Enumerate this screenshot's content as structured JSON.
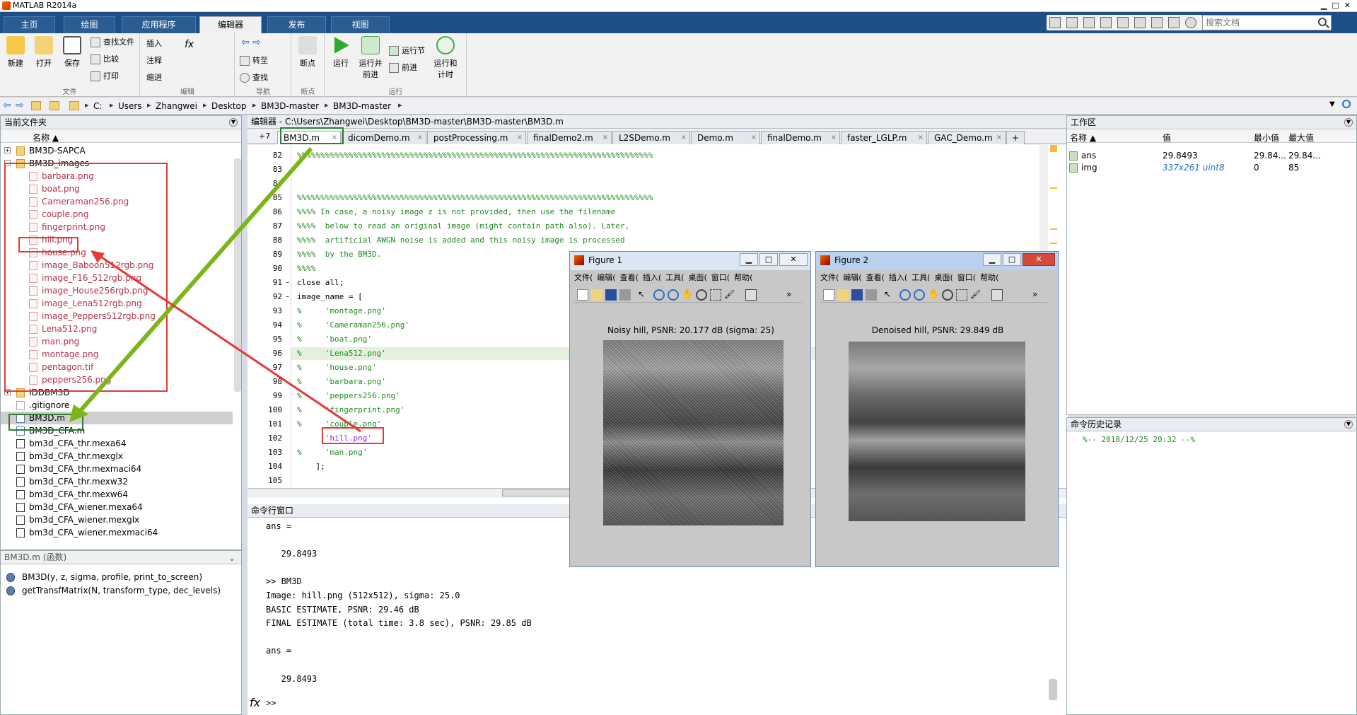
{
  "window": {
    "title": "MATLAB R2014a"
  },
  "ribbon_tabs": [
    "主页",
    "绘图",
    "应用程序",
    "编辑器",
    "发布",
    "视图"
  ],
  "search": {
    "placeholder": "搜索文档"
  },
  "toolstrip": {
    "file": {
      "label": "文件",
      "new": "新建",
      "open": "打开",
      "save": "保存",
      "find_files": "查找文件",
      "compare": "比较",
      "print": "打印"
    },
    "edit": {
      "label": "编辑",
      "insert": "插入",
      "comment": "注释",
      "indent": "缩进"
    },
    "navigate": {
      "label": "导航",
      "goto": "转至",
      "find": "查找"
    },
    "breakpoints": {
      "label": "断点",
      "breakpoints": "断点"
    },
    "run": {
      "label": "运行",
      "run": "运行",
      "run_advance_1": "运行并",
      "run_advance_2": "前进",
      "run_section": "运行节",
      "advance": "前进",
      "run_time_1": "运行和",
      "run_time_2": "计时"
    }
  },
  "breadcrumb": [
    "C:",
    "Users",
    "Zhangwei",
    "Desktop",
    "BM3D-master",
    "BM3D-master"
  ],
  "current_folder": {
    "title": "当前文件夹",
    "name_col": "名称 ▲",
    "items": [
      {
        "name": "BM3D-SAPCA",
        "type": "folder"
      },
      {
        "name": "BM3D_images",
        "type": "folder"
      },
      {
        "name": "barbara.png",
        "type": "png"
      },
      {
        "name": "boat.png",
        "type": "png"
      },
      {
        "name": "Cameraman256.png",
        "type": "png"
      },
      {
        "name": "couple.png",
        "type": "png"
      },
      {
        "name": "fingerprint.png",
        "type": "png"
      },
      {
        "name": "hill.png",
        "type": "png"
      },
      {
        "name": "house.png",
        "type": "png"
      },
      {
        "name": "image_Baboon512rgb.png",
        "type": "png"
      },
      {
        "name": "image_F16_512rgb.png",
        "type": "png"
      },
      {
        "name": "image_House256rgb.png",
        "type": "png"
      },
      {
        "name": "image_Lena512rgb.png",
        "type": "png"
      },
      {
        "name": "image_Peppers512rgb.png",
        "type": "png"
      },
      {
        "name": "Lena512.png",
        "type": "png"
      },
      {
        "name": "man.png",
        "type": "png"
      },
      {
        "name": "montage.png",
        "type": "png"
      },
      {
        "name": "pentagon.tif",
        "type": "tif"
      },
      {
        "name": "peppers256.png",
        "type": "png"
      },
      {
        "name": "IDDBM3D",
        "type": "folder"
      },
      {
        "name": ".gitignore",
        "type": "file"
      },
      {
        "name": "BM3D.m",
        "type": "m"
      },
      {
        "name": "BM3D_CFA.m",
        "type": "m"
      },
      {
        "name": "bm3d_CFA_thr.mexa64",
        "type": "mex"
      },
      {
        "name": "bm3d_CFA_thr.mexglx",
        "type": "mex"
      },
      {
        "name": "bm3d_CFA_thr.mexmaci64",
        "type": "mex"
      },
      {
        "name": "bm3d_CFA_thr.mexw32",
        "type": "mex"
      },
      {
        "name": "bm3d_CFA_thr.mexw64",
        "type": "mex"
      },
      {
        "name": "bm3d_CFA_wiener.mexa64",
        "type": "mex"
      },
      {
        "name": "bm3d_CFA_wiener.mexglx",
        "type": "mex"
      },
      {
        "name": "bm3d_CFA_wiener.mexmaci64",
        "type": "mex"
      }
    ]
  },
  "details": {
    "title": "BM3D.m (函数)",
    "functions": [
      "BM3D(y, z, sigma, profile, print_to_screen)",
      "getTransfMatrix(N, transform_type, dec_levels)"
    ]
  },
  "editor": {
    "title": "编辑器 - C:\\Users\\Zhangwei\\Desktop\\BM3D-master\\BM3D-master\\BM3D.m",
    "tabs": [
      "BM3D.m",
      "dicomDemo.m",
      "postProcessing.m",
      "finalDemo2.m",
      "L2SDemo.m",
      "Demo.m",
      "finalDemo.m",
      "faster_LGLP.m",
      "GAC_Demo.m"
    ],
    "lines": [
      {
        "n": "82",
        "t": "%%%%%%%%%%%%%%%%%%%%%%%%%%%%%%%%%%%%%%%%%%%%%%%%%%%%%%%%%%%%%%%%%%%%%%%%%%%%",
        "c": "cm"
      },
      {
        "n": "83",
        "t": "",
        "c": ""
      },
      {
        "n": "84",
        "t": "",
        "c": ""
      },
      {
        "n": "85",
        "t": "%%%%%%%%%%%%%%%%%%%%%%%%%%%%%%%%%%%%%%%%%%%%%%%%%%%%%%%%%%%%%%%%%%%%%%%%%%%%",
        "c": "cm"
      },
      {
        "n": "86",
        "t": "%%%% In case, a noisy image z is not provided, then use the filename",
        "c": "cm"
      },
      {
        "n": "87",
        "t": "%%%%  below to read an original image (might contain path also). Later,",
        "c": "cm"
      },
      {
        "n": "88",
        "t": "%%%%  artificial AWGN noise is added and this noisy image is processed",
        "c": "cm"
      },
      {
        "n": "89",
        "t": "%%%%  by the BM3D.",
        "c": "cm"
      },
      {
        "n": "90",
        "t": "%%%%",
        "c": "cm"
      },
      {
        "n": "91",
        "t": "close all;",
        "c": ""
      },
      {
        "n": "92",
        "t": "image_name = [",
        "c": ""
      },
      {
        "n": "93",
        "t": "%     'montage.png'",
        "c": "cm"
      },
      {
        "n": "94",
        "t": "%     'Cameraman256.png'",
        "c": "cm"
      },
      {
        "n": "95",
        "t": "%     'boat.png'",
        "c": "cm"
      },
      {
        "n": "96",
        "t": "%     'Lena512.png'",
        "c": "cm"
      },
      {
        "n": "97",
        "t": "%     'house.png'",
        "c": "cm"
      },
      {
        "n": "98",
        "t": "%     'barbara.png'",
        "c": "cm"
      },
      {
        "n": "99",
        "t": "%     'peppers256.png'",
        "c": "cm"
      },
      {
        "n": "100",
        "t": "%     'fingerprint.png'",
        "c": "cm"
      },
      {
        "n": "101",
        "t": "%     'couple.png'",
        "c": "cm"
      },
      {
        "n": "102",
        "t": "      'hill.png'",
        "c": "str"
      },
      {
        "n": "103",
        "t": "%     'man.png'",
        "c": "cm"
      },
      {
        "n": "104",
        "t": "    ];",
        "c": ""
      },
      {
        "n": "105",
        "t": "",
        "c": ""
      }
    ]
  },
  "command_window": {
    "title": "命令行窗口",
    "lines": [
      "ans =",
      "",
      "   29.8493",
      "",
      ">> BM3D",
      "Image: hill.png (512x512), sigma: 25.0",
      "BASIC ESTIMATE, PSNR: 29.46 dB",
      "FINAL ESTIMATE (total time: 3.8 sec), PSNR: 29.85 dB",
      "",
      "ans =",
      "",
      "   29.8493"
    ],
    "prompt": ">>",
    "fx": "fx"
  },
  "workspace": {
    "title": "工作区",
    "cols": [
      "名称 ▲",
      "值",
      "最小值",
      "最大值"
    ],
    "rows": [
      {
        "name": "ans",
        "value": "29.8493",
        "min": "29.84...",
        "max": "29.84..."
      },
      {
        "name": "img",
        "value": "337x261 uint8",
        "min": "0",
        "max": "85"
      }
    ]
  },
  "history": {
    "title": "命令历史记录",
    "entry": "%-- 2018/12/25 20:32 --%"
  },
  "figures": [
    {
      "title": "Figure 1",
      "menu": [
        "文件(",
        "编辑(",
        "查看(",
        "插入(",
        "工具(",
        "桌面(",
        "窗口(",
        "帮助("
      ],
      "caption": "Noisy hill, PSNR: 20.177 dB (sigma: 25)"
    },
    {
      "title": "Figure 2",
      "menu": [
        "文件(",
        "编辑(",
        "查看(",
        "插入(",
        "工具(",
        "桌面(",
        "窗口(",
        "帮助("
      ],
      "caption": "Denoised hill, PSNR: 29.849 dB"
    }
  ],
  "colors": {
    "ribbon": "#1d4f86",
    "annotation_red": "#e53935",
    "annotation_green": "#7cb518",
    "comment": "#228b22",
    "string": "#a020f0"
  }
}
